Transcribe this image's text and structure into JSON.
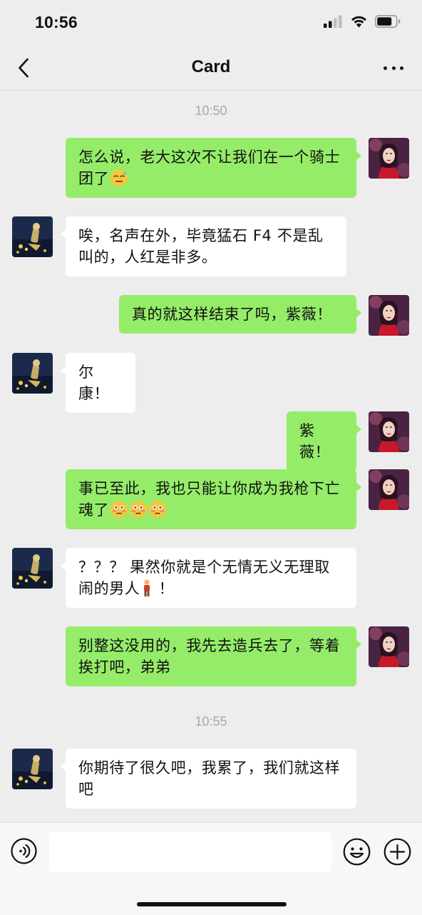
{
  "status_bar": {
    "time": "10:56"
  },
  "nav": {
    "title": "Card",
    "back_icon": "chevron-left-icon",
    "more_icon": "ellipsis-icon"
  },
  "chat": {
    "timestamps": [
      "10:50",
      "10:55"
    ],
    "messages": [
      {
        "side": "out",
        "text": "怎么说，老大这次不让我们在一个骑士团了",
        "emojis": [
          "😓"
        ]
      },
      {
        "side": "in",
        "text": "唉，名声在外，毕竟猛石 F4 不是乱叫的，人红是非多。",
        "emojis": []
      },
      {
        "side": "out",
        "text": "真的就这样结束了吗，紫薇！",
        "emojis": []
      },
      {
        "side": "in",
        "text": "尔康！",
        "emojis": []
      },
      {
        "side": "out",
        "text": "紫薇！",
        "emojis": []
      },
      {
        "side": "out",
        "text": "事已至此，我也只能让你成为我枪下亡魂了",
        "emojis": [
          "😳",
          "😳",
          "😳"
        ]
      },
      {
        "side": "in",
        "text": "？？？ 果然你就是个无情无义无理取闹的男人",
        "text_after": " ！",
        "emojis": [
          "🧍"
        ]
      },
      {
        "side": "out",
        "text": "别整这没用的，我先去造兵去了，等着挨打吧，弟弟",
        "emojis": []
      },
      {
        "side": "in",
        "text": "你期待了很久吧，我累了，我们就这样吧",
        "emojis": []
      }
    ]
  },
  "colors": {
    "background": "#ededed",
    "outgoing_bubble": "#95ec69",
    "incoming_bubble": "#ffffff",
    "timestamp": "#a8a8a8"
  },
  "input_bar": {
    "value": "",
    "voice_icon": "voice-icon",
    "emoji_icon": "smiley-icon",
    "plus_icon": "plus-circle-icon"
  }
}
